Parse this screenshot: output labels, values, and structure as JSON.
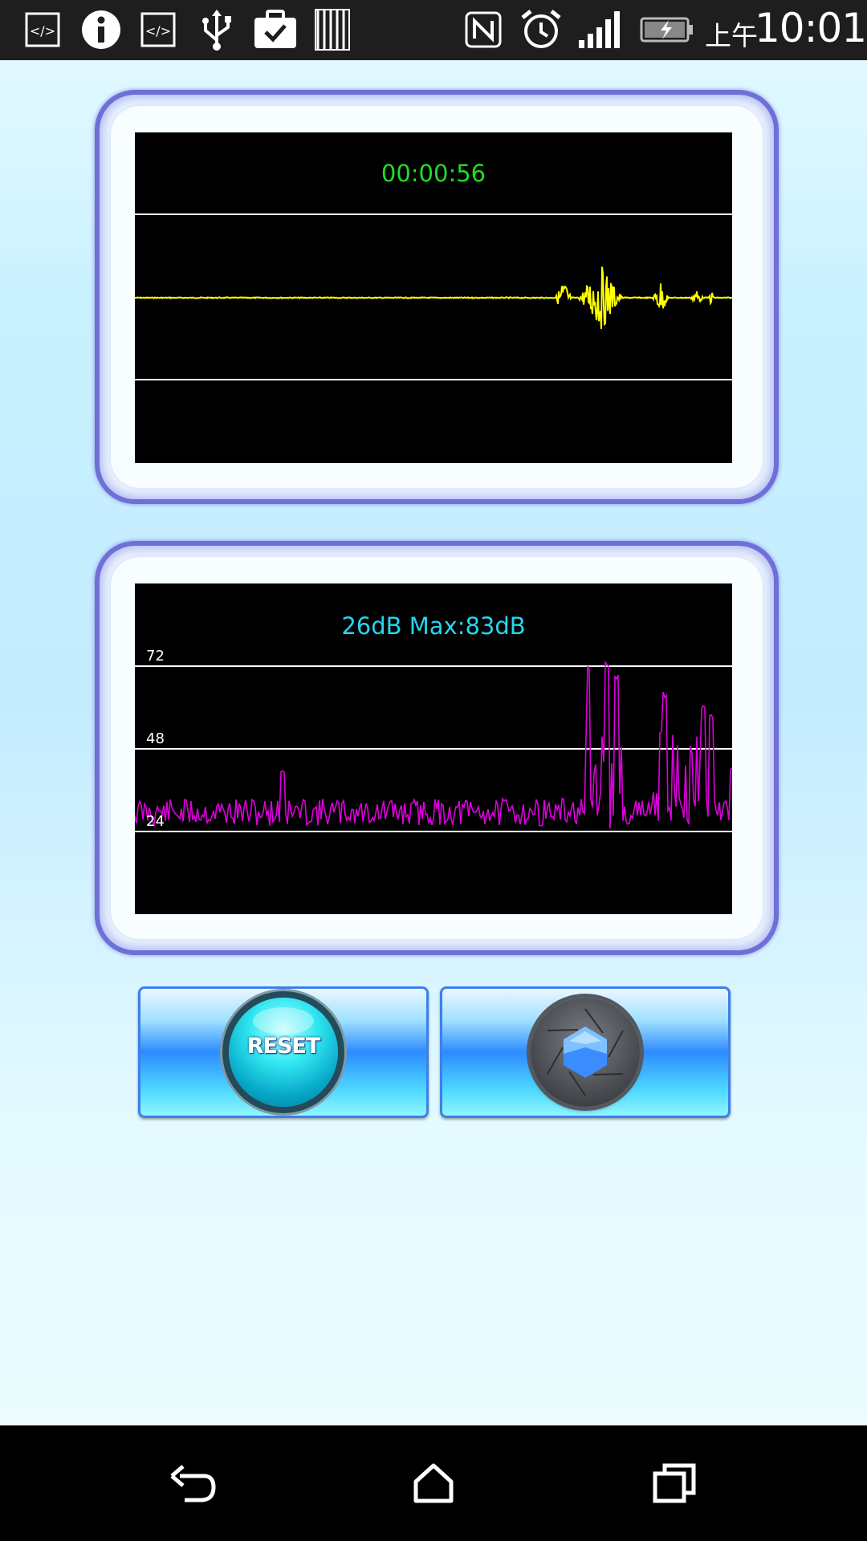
{
  "status_bar": {
    "icons": [
      "code-icon",
      "info-icon",
      "code-icon",
      "usb-icon",
      "briefcase-check-icon",
      "sim-icon",
      "nfc-icon",
      "alarm-icon",
      "signal-icon",
      "battery-charging-icon"
    ],
    "ampm": "上午",
    "time": "10:01"
  },
  "waveform_panel": {
    "timer": "00:00:56",
    "wave_color": "#ffff00",
    "timer_color": "#22dd22"
  },
  "decibel_panel": {
    "reading": "26dB Max:83dB",
    "reading_color": "#26d6ee",
    "line_color": "#dd00dd",
    "gridlines": [
      "72",
      "48",
      "24"
    ]
  },
  "buttons": {
    "reset_label": "RESET",
    "capture": "camera-shutter-icon"
  },
  "nav_bar": {
    "buttons": [
      "back-icon",
      "home-icon",
      "recent-apps-icon"
    ]
  }
}
